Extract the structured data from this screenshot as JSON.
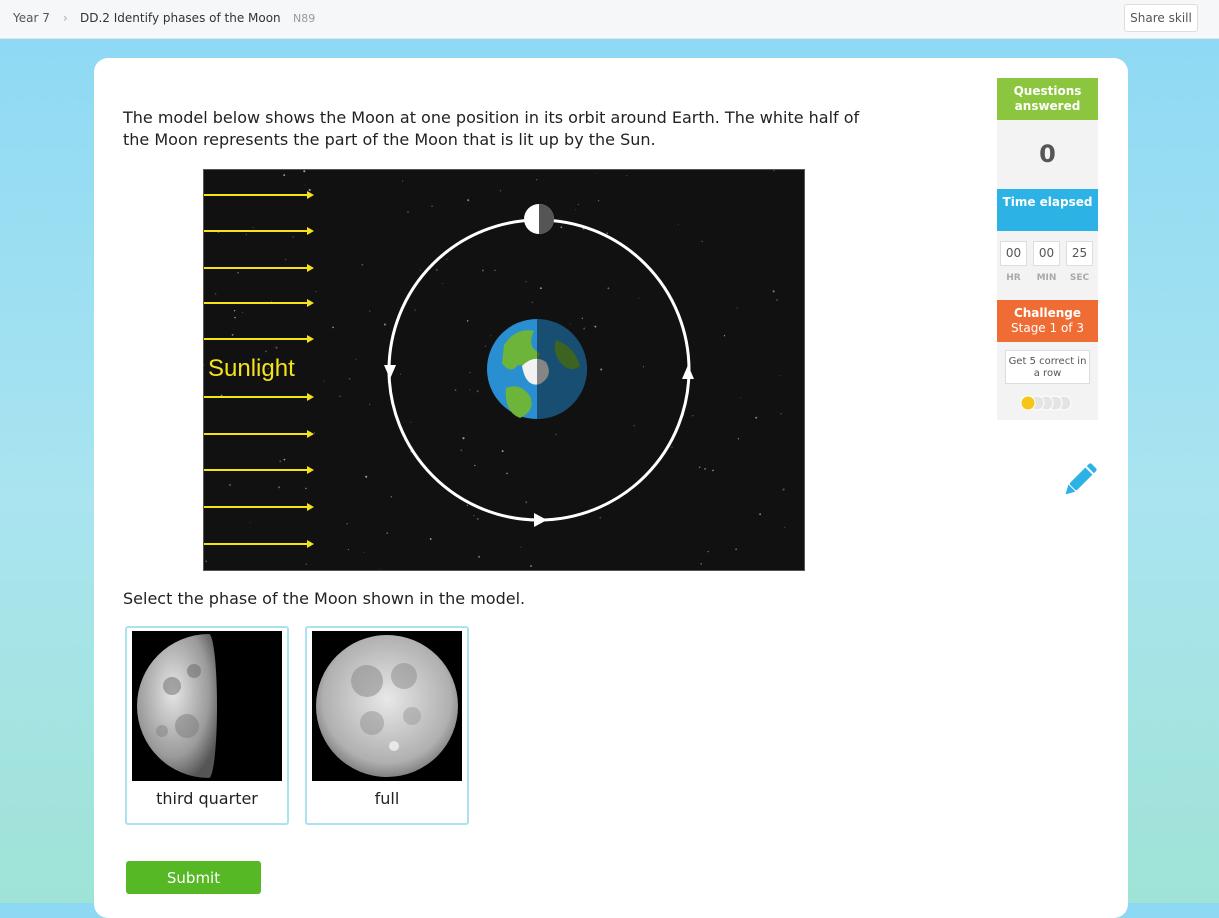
{
  "breadcrumb": {
    "level": "Year 7",
    "separator": "›",
    "skill": "DD.2 Identify phases of the Moon",
    "code": "N89"
  },
  "header": {
    "share_label": "Share skill"
  },
  "question": {
    "text": "The model below shows the Moon at one position in its orbit around Earth. The white half of the Moon represents the part of the Moon that is lit up by the Sun.",
    "model_label": "Sunlight",
    "prompt": "Select the phase of the Moon shown in the model."
  },
  "choices": [
    {
      "label": "third quarter",
      "icon": "third-quarter-moon"
    },
    {
      "label": "full",
      "icon": "full-moon"
    }
  ],
  "submit_label": "Submit",
  "sidebar": {
    "questions_answered_label": "Questions answered",
    "questions_answered_value": "0",
    "time_label": "Time elapsed",
    "time": {
      "hr": "00",
      "min": "00",
      "sec": "25"
    },
    "time_units": {
      "hr": "HR",
      "min": "MIN",
      "sec": "SEC"
    },
    "challenge_label": "Challenge",
    "challenge_stage": "Stage 1 of 3",
    "challenge_goal": "Get 5 correct in a row",
    "progress_filled": 1,
    "progress_total": 5
  },
  "colors": {
    "accent_green": "#8cc63e",
    "accent_blue": "#2db2e6",
    "accent_orange": "#ef6c34",
    "submit_green": "#55b824",
    "sunlight_yellow": "#f5e31a"
  }
}
